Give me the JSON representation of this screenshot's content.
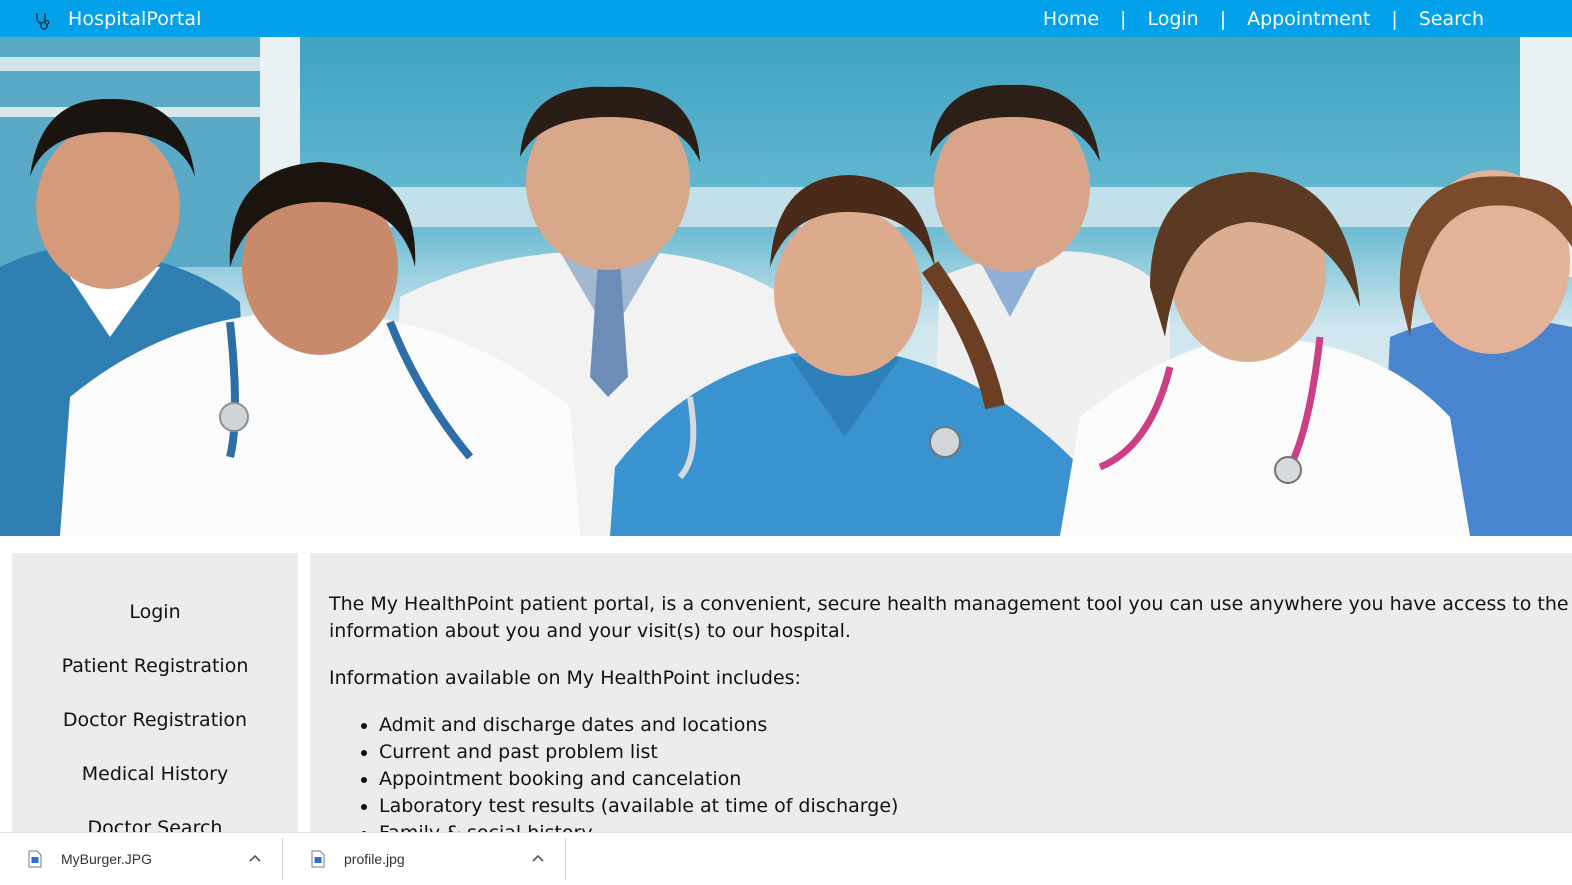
{
  "brand": {
    "name": "HospitalPortal",
    "icon": "stethoscope-icon"
  },
  "nav": {
    "home": "Home",
    "login": "Login",
    "appointment": "Appointment",
    "search": "Search",
    "separator": "|"
  },
  "hero": {
    "image": "group-of-medical-staff-photo"
  },
  "sidebar": {
    "items": [
      {
        "label": "Login"
      },
      {
        "label": "Patient Registration"
      },
      {
        "label": "Doctor Registration"
      },
      {
        "label": "Medical History"
      },
      {
        "label": "Doctor Search"
      }
    ]
  },
  "content": {
    "intro": "The My HealthPoint patient portal, is a convenient, secure health management tool you can use anywhere you have access to the Internet",
    "intro_line2": "information about you and your visit(s) to our hospital.",
    "info_heading": "Information available on My HealthPoint includes:",
    "features": [
      "Admit and discharge dates and locations",
      "Current and past problem list",
      "Appointment booking and cancelation",
      "Laboratory test results (available at time of discharge)",
      "Family & social history"
    ]
  },
  "downloads": [
    {
      "name": "MyBurger.JPG"
    },
    {
      "name": "profile.jpg"
    }
  ],
  "colors": {
    "navbar": "#03a1ea",
    "panel": "#ececec"
  }
}
